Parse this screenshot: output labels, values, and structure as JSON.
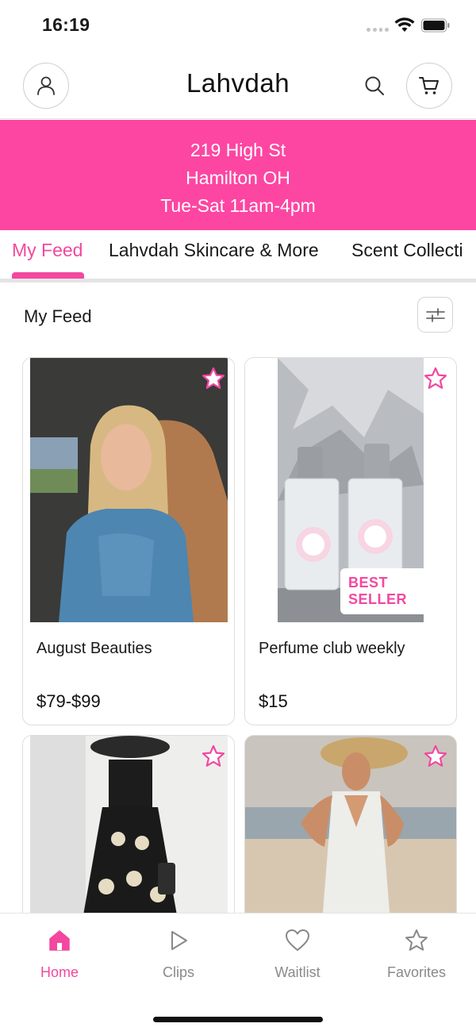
{
  "status_bar": {
    "time": "16:19"
  },
  "header": {
    "brand": "Lahvdah"
  },
  "banner": {
    "line1": "219 High St",
    "line2": "Hamilton OH",
    "line3": "Tue-Sat  11am-4pm"
  },
  "tabs": [
    {
      "label": "My Feed",
      "active": true
    },
    {
      "label": "Lahvdah Skincare & More",
      "active": false
    },
    {
      "label": "Scent Collecti",
      "active": false
    }
  ],
  "section": {
    "title": "My Feed"
  },
  "products": [
    {
      "name": "August Beauties",
      "price": "$79-$99",
      "image": "woman-in-car-photo"
    },
    {
      "name": "Perfume club weekly",
      "price": "$15",
      "badge": "BEST SELLER",
      "image": "perfume-bottles-photo"
    },
    {
      "name": "",
      "price": "",
      "image": "black-dress-photo"
    },
    {
      "name": "",
      "price": "",
      "image": "white-jumpsuit-photo"
    }
  ],
  "bottom_nav": [
    {
      "label": "Home",
      "icon": "home-icon",
      "active": true
    },
    {
      "label": "Clips",
      "icon": "play-icon",
      "active": false
    },
    {
      "label": "Waitlist",
      "icon": "heart-icon",
      "active": false
    },
    {
      "label": "Favorites",
      "icon": "star-icon",
      "active": false
    }
  ],
  "colors": {
    "accent": "#f2489f",
    "banner": "#fd46a2"
  }
}
